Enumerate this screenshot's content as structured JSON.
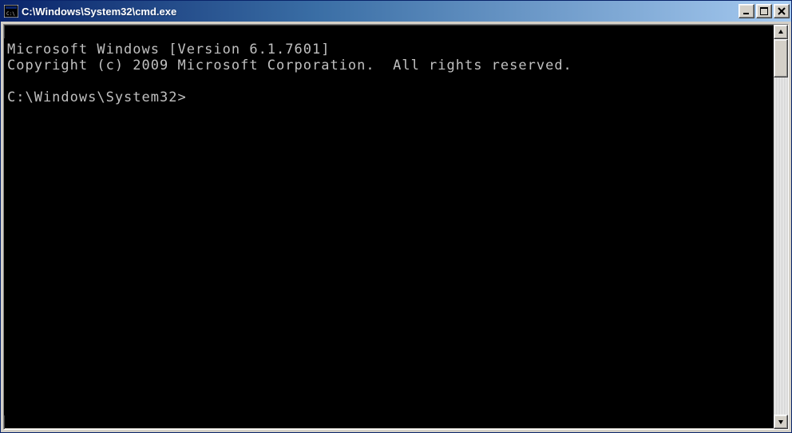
{
  "window": {
    "title": "C:\\Windows\\System32\\cmd.exe"
  },
  "console": {
    "lines": [
      "Microsoft Windows [Version 6.1.7601]",
      "Copyright (c) 2009 Microsoft Corporation.  All rights reserved.",
      "",
      "C:\\Windows\\System32>"
    ]
  }
}
